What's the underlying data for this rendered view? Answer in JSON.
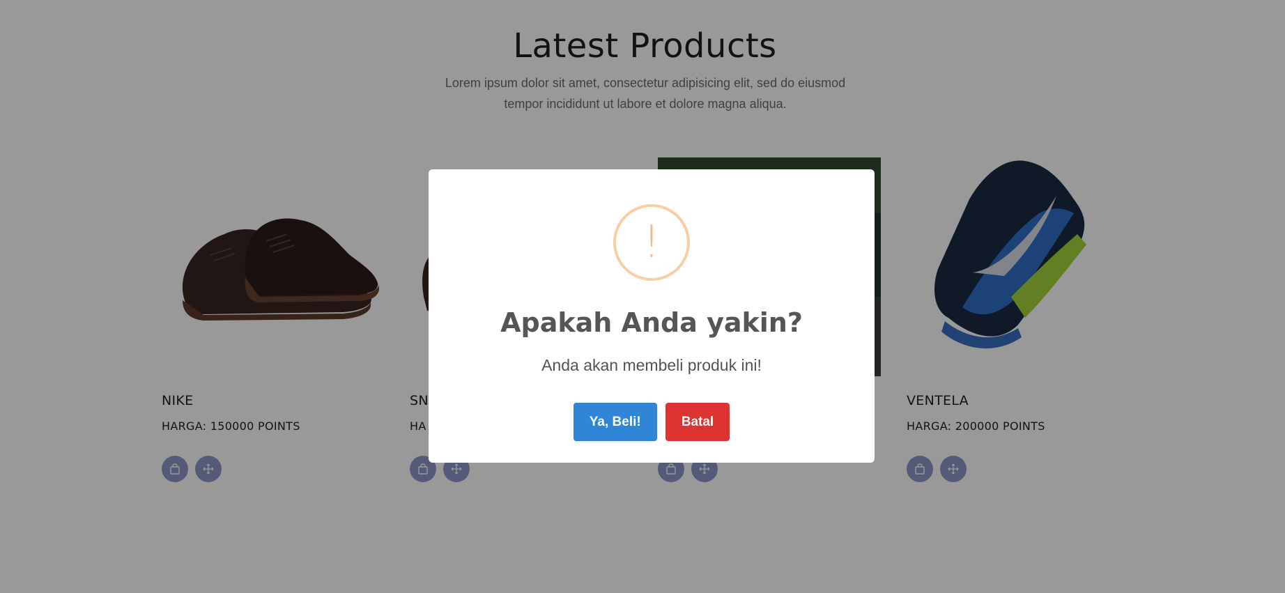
{
  "section": {
    "title": "Latest Products",
    "subtitle": "Lorem ipsum dolor sit amet, consectetur adipisicing elit, sed do eiusmod tempor incididunt ut labore et dolore magna aliqua."
  },
  "products": [
    {
      "name": "NIKE",
      "price": "HARGA: 150000 POINTS"
    },
    {
      "name": "SN",
      "price": "HA"
    },
    {
      "name": "",
      "price": ""
    },
    {
      "name": "VENTELA",
      "price": "HARGA: 200000 POINTS"
    }
  ],
  "icons": {
    "cart": "bag-icon",
    "compare": "arrows-move-icon",
    "warning": "exclamation-icon"
  },
  "modal": {
    "icon_glyph": "!",
    "title": "Apakah Anda yakin?",
    "text": "Anda akan membeli produk ini!",
    "confirm_label": "Ya, Beli!",
    "cancel_label": "Batal"
  },
  "colors": {
    "confirm": "#3085d6",
    "cancel": "#dd3333",
    "warning": "#f8bb86",
    "icon_button": "#8e97c8"
  }
}
